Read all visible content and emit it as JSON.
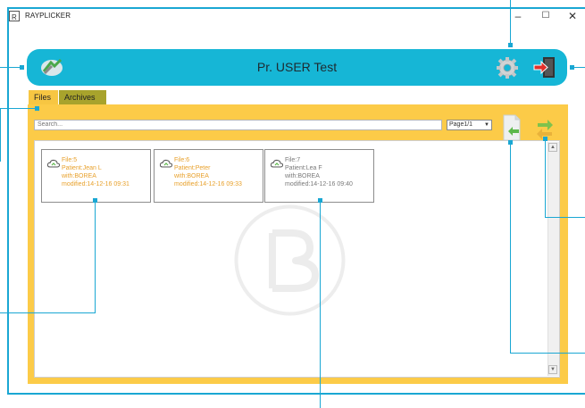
{
  "window": {
    "title": "RAYPLICKER",
    "minimize": "–",
    "maximize": "☐",
    "close": "✕"
  },
  "header": {
    "title": "Pr. USER Test"
  },
  "tabs": [
    {
      "label": "Files"
    },
    {
      "label": "Archives"
    }
  ],
  "search": {
    "placeholder": "Search..."
  },
  "pager": {
    "value": "Page1/1"
  },
  "files": [
    {
      "file": "File:5",
      "patient": "Patient:Jean L",
      "with": "with:BOREA",
      "modified": "modified:14-12-16 09:31",
      "state": "orange"
    },
    {
      "file": "File:6",
      "patient": "Patient:Peter",
      "with": "with:BOREA",
      "modified": "modified:14-12-16 09:33",
      "state": "orange"
    },
    {
      "file": "File:7",
      "patient": "Patient:Lea F",
      "with": "with:BOREA",
      "modified": "modified:14-12-16 09:40",
      "state": "gray"
    }
  ],
  "colors": {
    "header": "#16b6d6",
    "panel": "#fccb48",
    "tab_active": "#f7c642",
    "tab_inactive": "#a8a32c",
    "callout": "#1aa7d3",
    "file_orange": "#e8a12c",
    "file_gray": "#7a7a7a"
  }
}
